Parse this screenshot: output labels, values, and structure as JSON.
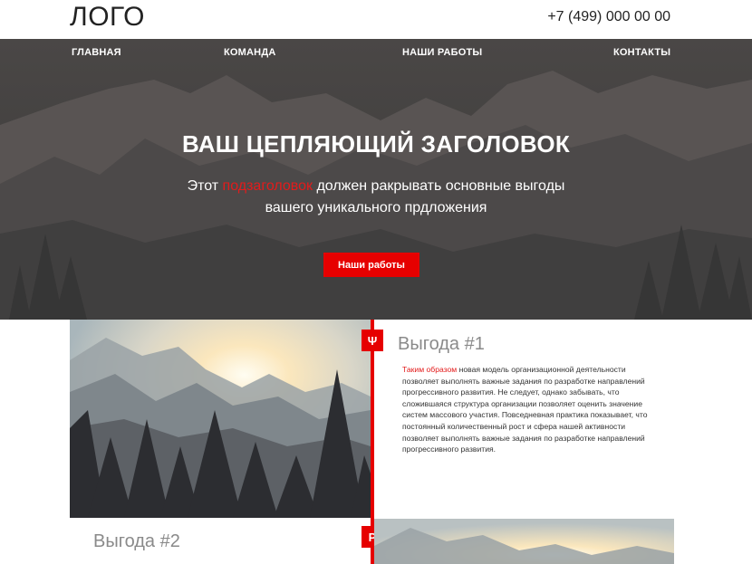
{
  "header": {
    "logo": "ЛОГО",
    "phone": "+7 (499) 000 00 00"
  },
  "nav": {
    "items": [
      {
        "label": "ГЛАВНАЯ"
      },
      {
        "label": "КОМАНДА"
      },
      {
        "label": "НАШИ РАБОТЫ"
      },
      {
        "label": "КОНТАКТЫ"
      }
    ]
  },
  "hero": {
    "title": "ВАШ ЦЕПЛЯЮЩИЙ ЗАГОЛОВОК",
    "subtitle_before": "Этот ",
    "subtitle_accent": "подзаголовок",
    "subtitle_after": " должен ракрывать основные выгоды",
    "subtitle_line2": "вашего уникального прдложения",
    "button_label": "Наши работы"
  },
  "benefits": [
    {
      "badge_icon": "Ψ",
      "title": "Выгода #1",
      "text_accent": "Таким образом",
      "text": " новая модель организационной деятельности позволяет выполнять важные задания по разработке направлений прогрессивного развития. Не следует, однако забывать, что сложившаяся структура организации позволяет оценить значение систем массового участия. Повседневная практика показывает, что постоянный количественный рост и сфера нашей активности позволяет выполнять важные задания по разработке направлений прогрессивного развития."
    },
    {
      "badge_icon": "Р",
      "title": "Выгода #2"
    }
  ],
  "colors": {
    "accent": "#e60000",
    "hero_bg": "#3f3d3c",
    "benefit_title": "#8a8a8a"
  }
}
